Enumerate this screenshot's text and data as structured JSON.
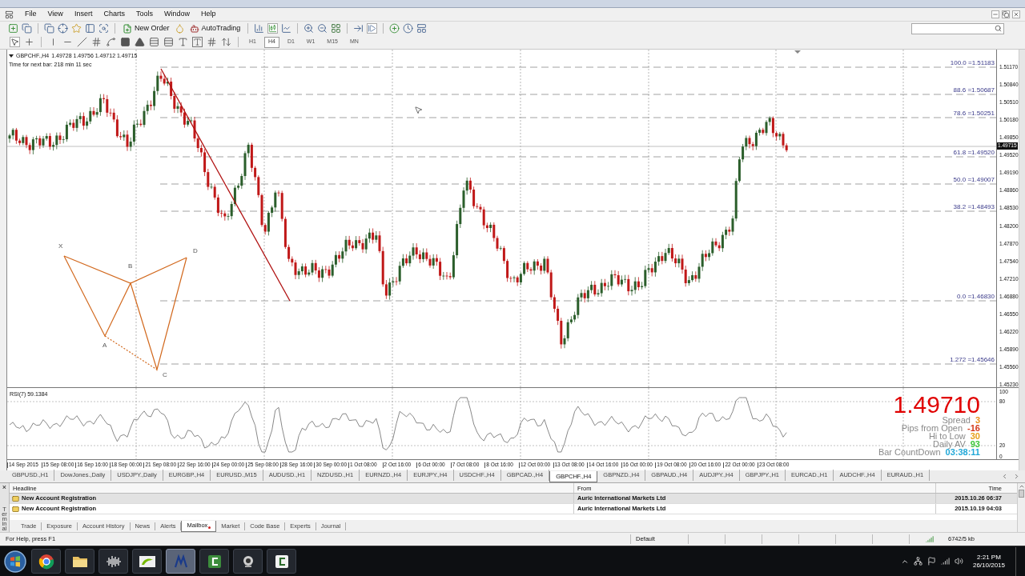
{
  "menu": [
    "File",
    "View",
    "Insert",
    "Charts",
    "Tools",
    "Window",
    "Help"
  ],
  "toolbar": {
    "new_order": "New Order",
    "auto_trading": "AutoTrading"
  },
  "timeframes": [
    {
      "label": "H1",
      "selected": false
    },
    {
      "label": "H4",
      "selected": true
    },
    {
      "label": "D1",
      "selected": false
    },
    {
      "label": "W1",
      "selected": false
    },
    {
      "label": "M15",
      "selected": false
    },
    {
      "label": "MN",
      "selected": false
    }
  ],
  "chart": {
    "symbol": "GBPCHF.,H4",
    "ohlc": "1.49728 1.49756 1.49712 1.49715",
    "timer": "Time for next bar: 218 min 11 sec",
    "price_axis": [
      "1.51170",
      "1.50840",
      "1.50510",
      "1.50180",
      "1.49850",
      "1.49520",
      "1.49190",
      "1.48860",
      "1.48530",
      "1.48200",
      "1.47870",
      "1.47540",
      "1.47210",
      "1.46880",
      "1.46550",
      "1.46220",
      "1.45890",
      "1.45560",
      "1.45230"
    ],
    "price_tag": "1.49715",
    "fib_levels": [
      "100.0 =1.51183",
      "88.6 =1.50687",
      "78.6 =1.50251",
      "61.8 =1.49520",
      "50.0 =1.49007",
      "38.2 =1.48493",
      "0.0 =1.46830",
      "1.272 =1.45646"
    ],
    "pattern_points": [
      "X",
      "B",
      "D",
      "A",
      "C"
    ],
    "time_axis": [
      "14 Sep 2015",
      "15 Sep 08:00",
      "16 Sep 16:00",
      "18 Sep 00:00",
      "21 Sep 08:00",
      "22 Sep 16:00",
      "24 Sep 00:00",
      "25 Sep 08:00",
      "28 Sep 16:00",
      "30 Sep 00:00",
      "1 Oct 08:00",
      "2 Oct 16:00",
      "6 Oct 00:00",
      "7 Oct 08:00",
      "8 Oct 16:00",
      "12 Oct 00:00",
      "13 Oct 08:00",
      "14 Oct 16:00",
      "16 Oct 00:00",
      "19 Oct 08:00",
      "20 Oct 16:00",
      "22 Oct 00:00",
      "23 Oct 08:00"
    ]
  },
  "rsi": {
    "title": "RSI(7) 59.1384",
    "axis": [
      "100",
      "80",
      "20",
      "0"
    ]
  },
  "info": {
    "price": "1.49710",
    "rows": [
      {
        "label": "Spread",
        "value": "3",
        "color": "#e8901a"
      },
      {
        "label": "Pips from Open",
        "value": "-16",
        "color": "#d43a1a"
      },
      {
        "label": "Hi to Low",
        "value": "30",
        "color": "#e8a01a"
      },
      {
        "label": "Daily AV",
        "value": "93",
        "color": "#3cc83c"
      },
      {
        "label": "Bar CountDown",
        "value": "03:38:11",
        "color": "#22a8d8"
      }
    ]
  },
  "symbol_tabs": [
    {
      "label": "GBPUSD.,H1",
      "selected": false
    },
    {
      "label": "DowJones.,Daily",
      "selected": false
    },
    {
      "label": "USDJPY.,Daily",
      "selected": false
    },
    {
      "label": "EURGBP.,H4",
      "selected": false
    },
    {
      "label": "EURUSD.,M15",
      "selected": false
    },
    {
      "label": "AUDUSD.,H1",
      "selected": false
    },
    {
      "label": "NZDUSD.,H1",
      "selected": false
    },
    {
      "label": "EURNZD.,H4",
      "selected": false
    },
    {
      "label": "EURJPY.,H4",
      "selected": false
    },
    {
      "label": "USDCHF.,H4",
      "selected": false
    },
    {
      "label": "GBPCAD.,H4",
      "selected": false
    },
    {
      "label": "GBPCHF.,H4",
      "selected": true
    },
    {
      "label": "GBPNZD.,H4",
      "selected": false
    },
    {
      "label": "GBPAUD.,H4",
      "selected": false
    },
    {
      "label": "AUDJPY.,H4",
      "selected": false
    },
    {
      "label": "GBPJPY.,H1",
      "selected": false
    },
    {
      "label": "EURCAD.,H1",
      "selected": false
    },
    {
      "label": "AUDCHF.,H4",
      "selected": false
    },
    {
      "label": "EURAUD.,H1",
      "selected": false
    }
  ],
  "terminal": {
    "side_label": "Terminal",
    "close": "×",
    "columns": [
      "Headline",
      "From",
      "Time"
    ],
    "rows": [
      {
        "headline": "New Account Registration",
        "from": "Auric International Markets Ltd",
        "time": "2015.10.26 06:37",
        "selected": true
      },
      {
        "headline": "New Account Registration",
        "from": "Auric International Markets Ltd",
        "time": "2015.10.19 04:03",
        "selected": false
      }
    ],
    "tabs": [
      {
        "label": "Trade",
        "selected": false
      },
      {
        "label": "Exposure",
        "selected": false
      },
      {
        "label": "Account History",
        "selected": false
      },
      {
        "label": "News",
        "selected": false
      },
      {
        "label": "Alerts",
        "selected": false
      },
      {
        "label": "Mailbox",
        "selected": true
      },
      {
        "label": "Market",
        "selected": false
      },
      {
        "label": "Code Base",
        "selected": false
      },
      {
        "label": "Experts",
        "selected": false
      },
      {
        "label": "Journal",
        "selected": false
      }
    ]
  },
  "status_bar": {
    "help": "For Help, press F1",
    "profile": "Default",
    "traffic": "6742/5 kb"
  },
  "taskbar": {
    "time": "2:21 PM",
    "date": "26/10/2015"
  }
}
